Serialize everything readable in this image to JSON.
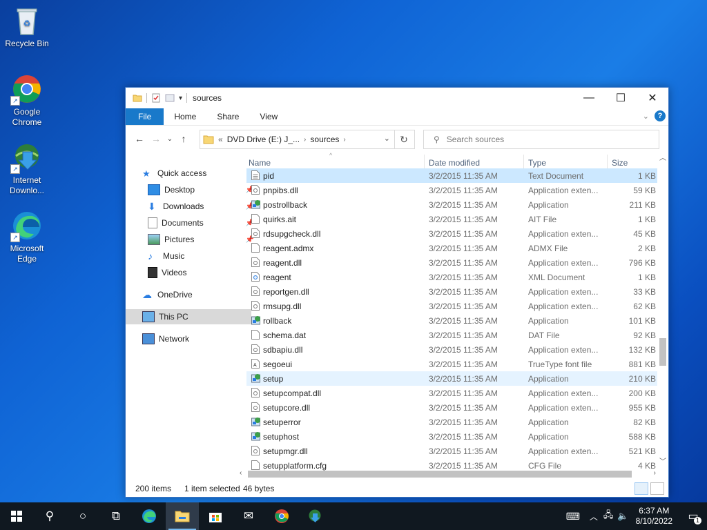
{
  "desktop": {
    "icons": [
      {
        "label": "Recycle Bin"
      },
      {
        "label": "Google Chrome"
      },
      {
        "label": "Internet Downlo..."
      },
      {
        "label": "Microsoft Edge"
      }
    ]
  },
  "window": {
    "title": "sources",
    "ribbon_tabs": [
      "File",
      "Home",
      "Share",
      "View"
    ],
    "address": {
      "prefix": "«",
      "segments": [
        "DVD Drive (E:) J_...",
        "sources"
      ]
    },
    "search_placeholder": "Search sources",
    "nav_pane": {
      "quick_access": "Quick access",
      "items": [
        {
          "label": "Desktop",
          "pinned": true
        },
        {
          "label": "Downloads",
          "pinned": true
        },
        {
          "label": "Documents",
          "pinned": true
        },
        {
          "label": "Pictures",
          "pinned": true
        },
        {
          "label": "Music",
          "pinned": false
        },
        {
          "label": "Videos",
          "pinned": false
        }
      ],
      "onedrive": "OneDrive",
      "this_pc": "This PC",
      "network": "Network"
    },
    "columns": {
      "name": "Name",
      "date": "Date modified",
      "type": "Type",
      "size": "Size"
    },
    "files": [
      {
        "name": "pid",
        "date": "3/2/2015 11:35 AM",
        "type": "Text Document",
        "size": "1 KB",
        "icon": "text-file"
      },
      {
        "name": "pnpibs.dll",
        "date": "3/2/2015 11:35 AM",
        "type": "Application exten...",
        "size": "59 KB",
        "icon": "dll-file"
      },
      {
        "name": "postrollback",
        "date": "3/2/2015 11:35 AM",
        "type": "Application",
        "size": "211 KB",
        "icon": "app-file"
      },
      {
        "name": "quirks.ait",
        "date": "3/2/2015 11:35 AM",
        "type": "AIT File",
        "size": "1 KB",
        "icon": "blank-file"
      },
      {
        "name": "rdsupgcheck.dll",
        "date": "3/2/2015 11:35 AM",
        "type": "Application exten...",
        "size": "45 KB",
        "icon": "dll-file"
      },
      {
        "name": "reagent.admx",
        "date": "3/2/2015 11:35 AM",
        "type": "ADMX File",
        "size": "2 KB",
        "icon": "blank-file"
      },
      {
        "name": "reagent.dll",
        "date": "3/2/2015 11:35 AM",
        "type": "Application exten...",
        "size": "796 KB",
        "icon": "dll-file"
      },
      {
        "name": "reagent",
        "date": "3/2/2015 11:35 AM",
        "type": "XML Document",
        "size": "1 KB",
        "icon": "xml-file"
      },
      {
        "name": "reportgen.dll",
        "date": "3/2/2015 11:35 AM",
        "type": "Application exten...",
        "size": "33 KB",
        "icon": "dll-file"
      },
      {
        "name": "rmsupg.dll",
        "date": "3/2/2015 11:35 AM",
        "type": "Application exten...",
        "size": "62 KB",
        "icon": "dll-file"
      },
      {
        "name": "rollback",
        "date": "3/2/2015 11:35 AM",
        "type": "Application",
        "size": "101 KB",
        "icon": "app-file"
      },
      {
        "name": "schema.dat",
        "date": "3/2/2015 11:35 AM",
        "type": "DAT File",
        "size": "92 KB",
        "icon": "blank-file"
      },
      {
        "name": "sdbapiu.dll",
        "date": "3/2/2015 11:35 AM",
        "type": "Application exten...",
        "size": "132 KB",
        "icon": "dll-file"
      },
      {
        "name": "segoeui",
        "date": "3/2/2015 11:35 AM",
        "type": "TrueType font file",
        "size": "881 KB",
        "icon": "font-file"
      },
      {
        "name": "setup",
        "date": "3/2/2015 11:35 AM",
        "type": "Application",
        "size": "210 KB",
        "icon": "app-file"
      },
      {
        "name": "setupcompat.dll",
        "date": "3/2/2015 11:35 AM",
        "type": "Application exten...",
        "size": "200 KB",
        "icon": "dll-file"
      },
      {
        "name": "setupcore.dll",
        "date": "3/2/2015 11:35 AM",
        "type": "Application exten...",
        "size": "955 KB",
        "icon": "dll-file"
      },
      {
        "name": "setuperror",
        "date": "3/2/2015 11:35 AM",
        "type": "Application",
        "size": "82 KB",
        "icon": "app-file"
      },
      {
        "name": "setuphost",
        "date": "3/2/2015 11:35 AM",
        "type": "Application",
        "size": "588 KB",
        "icon": "app-file"
      },
      {
        "name": "setupmgr.dll",
        "date": "3/2/2015 11:35 AM",
        "type": "Application exten...",
        "size": "521 KB",
        "icon": "dll-file"
      },
      {
        "name": "setupplatform.cfg",
        "date": "3/2/2015 11:35 AM",
        "type": "CFG File",
        "size": "4 KB",
        "icon": "blank-file"
      }
    ],
    "selected_file": "pid",
    "hovered_file": "setup",
    "status": {
      "count": "200 items",
      "selection": "1 item selected",
      "bytes": "46 bytes"
    }
  },
  "taskbar": {
    "apps": [
      "start-icon",
      "search-icon",
      "cortana-icon",
      "task-view-icon",
      "edge-icon",
      "file-explorer-icon",
      "store-icon",
      "mail-icon",
      "chrome-icon",
      "idm-icon"
    ],
    "active_app": "file-explorer-icon",
    "time": "6:37 AM",
    "date": "8/10/2022",
    "notification_count": "1"
  },
  "colors": {
    "accent": "#1979ca",
    "selection": "#cce8ff",
    "hover": "#e5f3ff",
    "taskbar": "#101820"
  }
}
